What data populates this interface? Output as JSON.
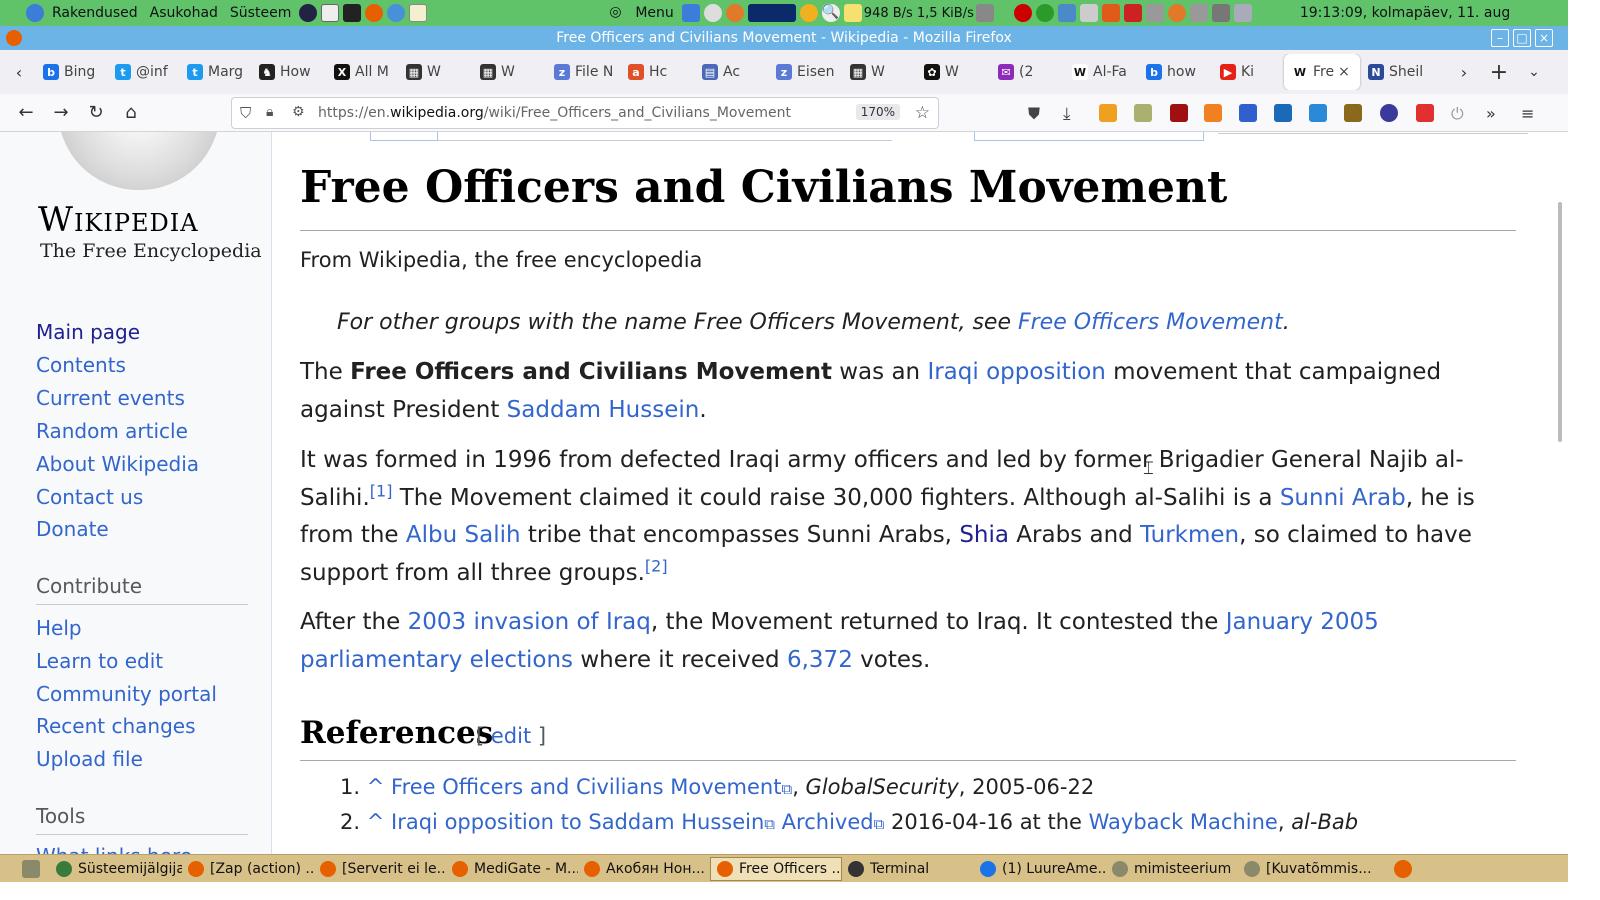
{
  "panel": {
    "menus": [
      "Rakendused",
      "Asukohad",
      "Süsteem"
    ],
    "menu_label": "Menu",
    "net_down": "948 B/s",
    "net_up": "1,5 KiB/s",
    "clock": "19:13:09, kolmapäev, 11. aug"
  },
  "window": {
    "title": "Free Officers and Civilians Movement - Wikipedia - Mozilla Firefox"
  },
  "tabs": [
    {
      "label": "Bing",
      "color": "#1a73e8",
      "glyph": "b"
    },
    {
      "label": "@inf",
      "color": "#1d9bf0",
      "glyph": "t"
    },
    {
      "label": "Marg",
      "color": "#1d9bf0",
      "glyph": "t"
    },
    {
      "label": "How",
      "color": "#222",
      "glyph": "♞"
    },
    {
      "label": "All M",
      "color": "#111",
      "glyph": "X"
    },
    {
      "label": "W",
      "color": "#333",
      "glyph": "▦"
    },
    {
      "label": "W",
      "color": "#333",
      "glyph": "▦"
    },
    {
      "label": "File N",
      "color": "#5a7ad6",
      "glyph": "z"
    },
    {
      "label": "Hc",
      "color": "#e0502a",
      "glyph": "a"
    },
    {
      "label": "Ac",
      "color": "#4a6ab8",
      "glyph": "▤"
    },
    {
      "label": "Eisen",
      "color": "#5a7ad6",
      "glyph": "z"
    },
    {
      "label": "W",
      "color": "#333",
      "glyph": "▦"
    },
    {
      "label": "W",
      "color": "#111",
      "glyph": "✿"
    },
    {
      "label": "(2",
      "color": "#8e2bb8",
      "glyph": "✉"
    },
    {
      "label": "Al-Fa",
      "color": "#fff",
      "glyph": "W"
    },
    {
      "label": "how",
      "color": "#1a73e8",
      "glyph": "b"
    },
    {
      "label": "Ki",
      "color": "#e62117",
      "glyph": "▶"
    },
    {
      "label": "Fre",
      "color": "#fff",
      "glyph": "W",
      "active": true
    },
    {
      "label": "Sheil",
      "color": "#2a4a9a",
      "glyph": "N"
    }
  ],
  "nav": {
    "url_prefix": "https://en.",
    "url_domain": "wikipedia.org",
    "url_path": "/wiki/Free_Officers_and_Civilians_Movement",
    "zoom": "170%"
  },
  "wiki": {
    "logo_word": "Wikipedia",
    "logo_tagline": "The Free Encyclopedia",
    "nav_links": [
      "Main page",
      "Contents",
      "Current events",
      "Random article",
      "About Wikipedia",
      "Contact us",
      "Donate"
    ],
    "contribute_heading": "Contribute",
    "contribute_links": [
      "Help",
      "Learn to edit",
      "Community portal",
      "Recent changes",
      "Upload file"
    ],
    "tools_heading": "Tools",
    "tools_first_link": "What links here",
    "title": "Free Officers and Civilians Movement",
    "from": "From Wikipedia, the free encyclopedia",
    "hatnote_text": "For other groups with the name Free Officers Movement, see ",
    "hatnote_link": "Free Officers Movement",
    "p1": {
      "t1": "The ",
      "bold": "Free Officers and Civilians Movement",
      "t2": " was an ",
      "l1": "Iraqi opposition",
      "t3": " movement that campaigned against President ",
      "l2": "Saddam Hussein",
      "t4": "."
    },
    "p2": {
      "t1": "It was formed in 1996 from defected Iraqi army officers and led by former Brigadier General Najib al-Salihi.",
      "sup1": "[1]",
      "t2": " The Movement claimed it could raise 30,000 fighters. Although al-Salihi is a ",
      "l1": "Sunni Arab",
      "t3": ", he is from the ",
      "l2": "Albu Salih",
      "t4": " tribe that encompasses Sunni Arabs, ",
      "l3": "Shia",
      "t5": " Arabs and ",
      "l4": "Turkmen",
      "t6": ", so claimed to have support from all three groups.",
      "sup2": "[2]"
    },
    "p3": {
      "t1": "After the ",
      "l1": "2003 invasion of Iraq",
      "t2": ", the Movement returned to Iraq. It contested the ",
      "l2": "January 2005 parliamentary elections",
      "t3": " where it received ",
      "l3": "6,372",
      "t4": " votes."
    },
    "references_heading": "References",
    "edit_label": "edit",
    "refs": [
      {
        "num": "1.",
        "link": "Free Officers and Civilians Movement",
        "source": "GlobalSecurity",
        "date": ", 2005-06-22"
      },
      {
        "num": "2.",
        "link": "Iraqi opposition to Saddam Hussein",
        "archived": "Archived",
        "t": " 2016-04-16 at the ",
        "wb": "Wayback Machine",
        "src": "al-Bab"
      }
    ]
  },
  "taskbar": [
    {
      "label": "Süsteemijälgija",
      "color": "#3a7a3a"
    },
    {
      "label": "[Zap (action) ...",
      "color": "#e66000"
    },
    {
      "label": "[Serverit ei le...",
      "color": "#e66000"
    },
    {
      "label": "MediGate - M...",
      "color": "#e66000"
    },
    {
      "label": "Акобян Нон...",
      "color": "#e66000"
    },
    {
      "label": "Free Officers ...",
      "color": "#e66000",
      "active": true
    },
    {
      "label": "Terminal",
      "color": "#333"
    },
    {
      "label": "(1) LuureAme...",
      "color": "#1a73e8"
    },
    {
      "label": "mimisteerium",
      "color": "#8a8a6a"
    },
    {
      "label": "[Kuvatõmmis...",
      "color": "#8a8a6a"
    }
  ]
}
